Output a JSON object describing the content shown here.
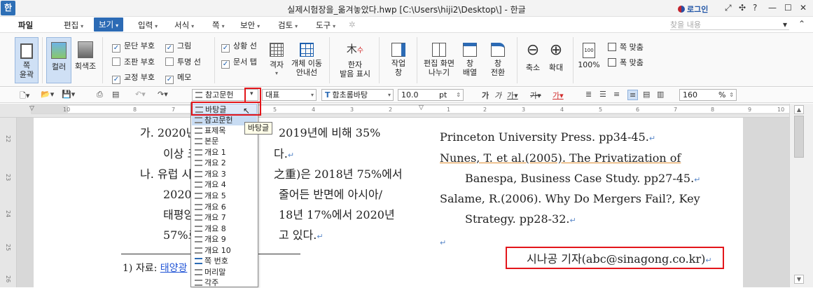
{
  "window": {
    "title": "실제시험장을_옮겨놓았다.hwp [C:\\Users\\hiji2\\Desktop\\] - 한글",
    "app_icon": "한",
    "login": "로그인"
  },
  "menubar": {
    "items": [
      "파일",
      "편집",
      "보기",
      "입력",
      "서식",
      "쪽",
      "보안",
      "검토",
      "도구"
    ],
    "active": "보기",
    "search_placeholder": "찾을 내용"
  },
  "ribbon": {
    "page_outline": "쪽\n윤곽",
    "color": "컬러",
    "grayscale": "회색조",
    "checks": [
      {
        "label": "문단 부호",
        "checked": true
      },
      {
        "label": "조판 부호",
        "checked": false
      },
      {
        "label": "교정 부호",
        "checked": true
      },
      {
        "label": "그림",
        "checked": true
      },
      {
        "label": "투명 선",
        "checked": false
      },
      {
        "label": "메모",
        "checked": true
      },
      {
        "label": "상황 선",
        "checked": true
      },
      {
        "label": "문서 탭",
        "checked": true
      }
    ],
    "grid": "격자",
    "object_move_guide": "개체 이동\n안내선",
    "hanja_reading": "한자\n발음 표시",
    "workspace": "작업\n창",
    "split_view": "편집 화면\n나누기",
    "arrange": "창\n배열",
    "switch": "창\n전환",
    "zoom_out": "축소",
    "zoom_in": "확대",
    "zoom100": "100%",
    "fit_page": "쪽 맞춤",
    "fit_width": "폭 맞춤"
  },
  "toolbar": {
    "style": "참고문헌",
    "lang": "대표",
    "font": "함초롬바탕",
    "size": "10.0",
    "unit": "pt",
    "zoom": "160",
    "zoom_unit": "%"
  },
  "style_dropdown": {
    "items": [
      "바탕글",
      "참고문헌",
      "표제목",
      "본문",
      "개요 1",
      "개요 2",
      "개요 3",
      "개요 4",
      "개요 5",
      "개요 6",
      "개요 7",
      "개요 8",
      "개요 9",
      "개요 10",
      "쪽 번호",
      "머리말",
      "각주"
    ],
    "hover": "바탕글",
    "selected": "참고문헌",
    "tooltip": "바탕글"
  },
  "document": {
    "left": {
      "line1a": "가. 2020년",
      "line1b": "2019년에 비해 35%",
      "line2a": "이상 크",
      "line2b": "다.",
      "line3a": "나. 유럽 시",
      "line3b": "之重)은 2018년 75%에서",
      "line4a": "2020년",
      "line4b": "줄어든 반면에 아시아/",
      "line5a": "태평양",
      "line5b": "18년 17%에서 2020년",
      "line6a": "57%로",
      "line6b": "고 있다.",
      "footnote_num": "1) 자료: ",
      "footnote_link": "태양광"
    },
    "right": {
      "r1": "Princeton University Press. pp34-45.",
      "r2": "Nunes, T. et al.(2005). The Privatization of",
      "r3": "Banespa, Business Case Study. pp27-45.",
      "r4": "Salame, R.(2006). Why Do Mergers Fail?, Key",
      "r5": "Strategy. pp28-32.",
      "byline": "시나공 기자(abc@sinagong.co.kr)"
    }
  },
  "ruler_ticks": [
    "10",
    "8",
    "7",
    "6",
    "5",
    "4",
    "3",
    "2",
    "1",
    "1",
    "2",
    "3",
    "4",
    "5",
    "6",
    "7",
    "8",
    "9",
    "10"
  ],
  "vruler_ticks": [
    "22",
    "23",
    "24",
    "25",
    "26"
  ]
}
